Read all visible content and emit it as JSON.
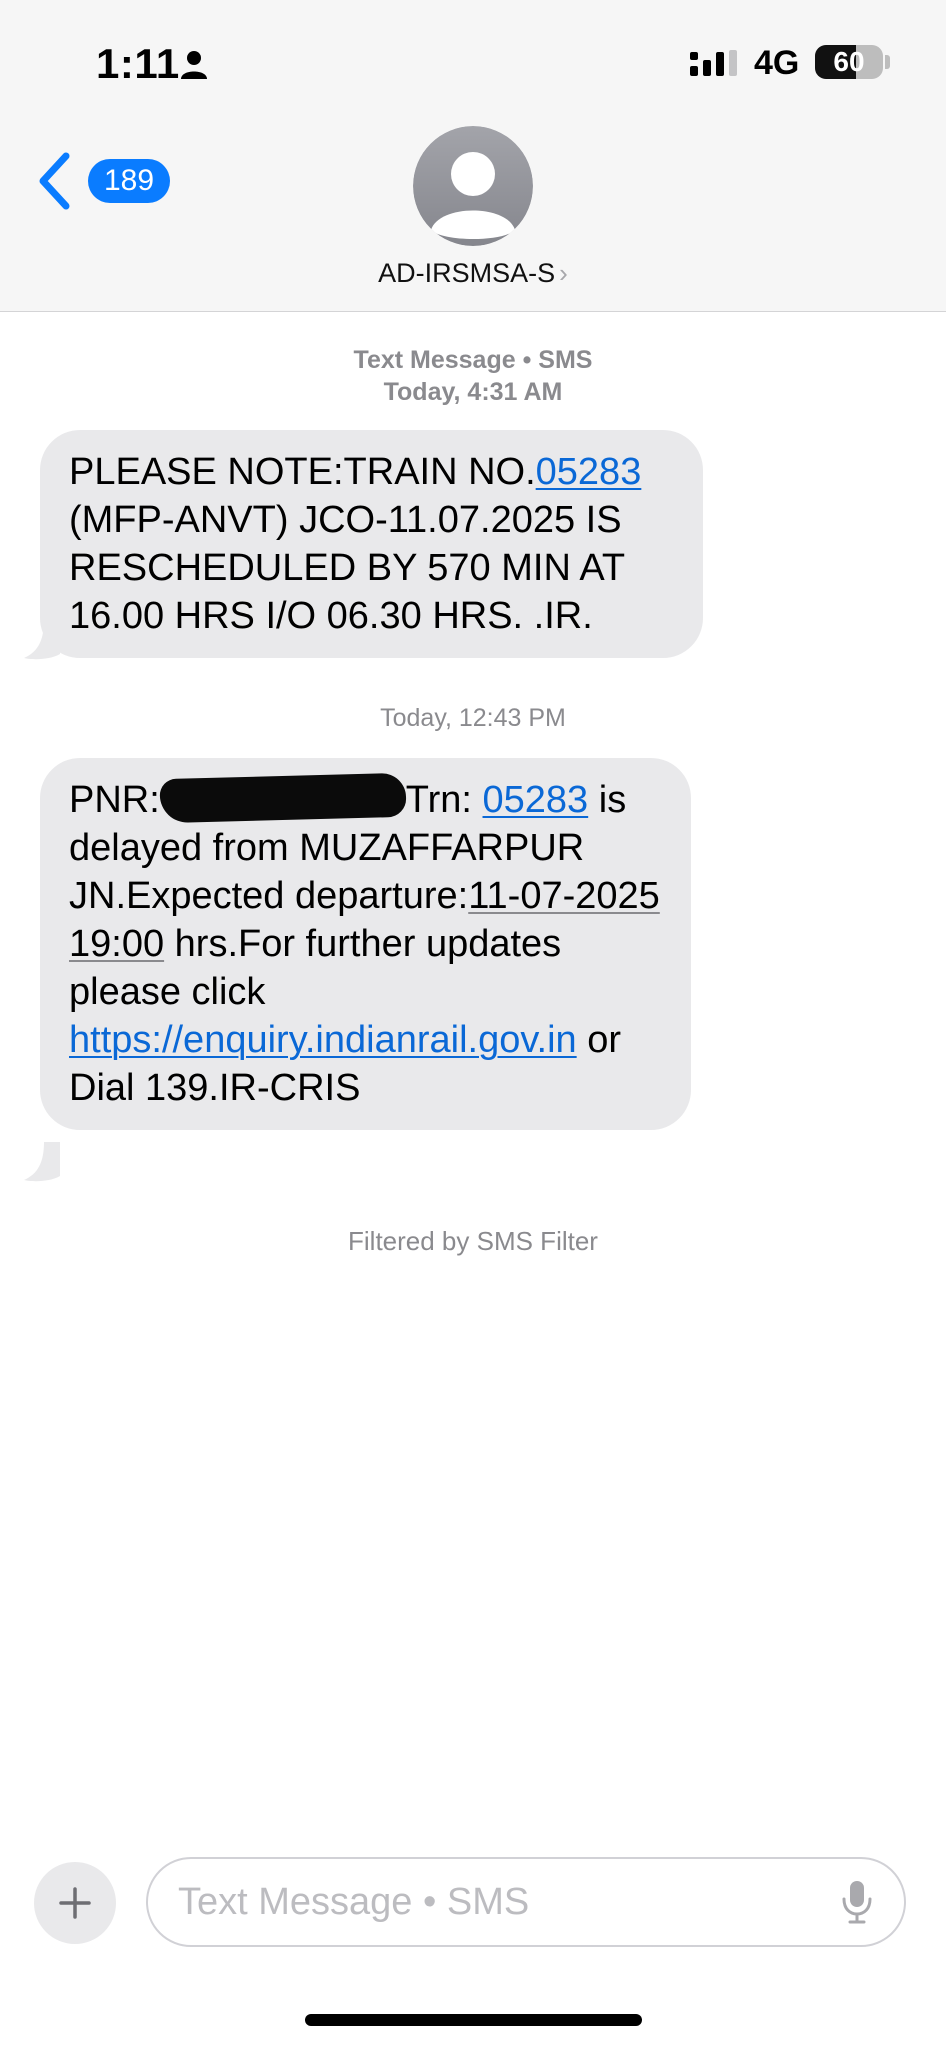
{
  "status_bar": {
    "time": "1:11",
    "network": "4G",
    "battery": "60",
    "battery_level": 0.6
  },
  "nav": {
    "back_count": "189",
    "contact_name": "AD-IRSMSA-S",
    "contact_chevron": "›"
  },
  "messages": [
    {
      "meta_label": "Text Message • SMS",
      "meta_time": "Today, 4:31 AM",
      "text_before_link": "PLEASE NOTE:TRAIN NO.",
      "link": "05283",
      "text_after_link": " (MFP-ANVT) JCO-11.07.2025 IS RESCHEDULED BY 570 MIN AT 16.00 HRS I/O 06.30 HRS. .IR."
    },
    {
      "meta_time": "Today, 12:43 PM",
      "pnr_label": "PNR:",
      "trn_label": "Trn: ",
      "train_link": "05283",
      "text_delayed": " is delayed from MUZAFFARPUR JN.Expected departure:",
      "departure": "11-07-2025 19:00",
      "text_updates": " hrs.For further updates please click ",
      "url_link": "https://enquiry.indianrail.gov.in",
      "text_end": " or Dial 139.IR-CRIS"
    }
  ],
  "filter_note": "Filtered by SMS Filter",
  "composer": {
    "placeholder": "Text Message • SMS"
  },
  "icons": {
    "back": "chevron-left-icon",
    "avatar": "person-silhouette-icon",
    "plus": "plus-icon",
    "mic": "microphone-icon",
    "signal": "cellular-signal-icon"
  },
  "colors": {
    "accent": "#0a7cff",
    "link": "#0a68d6",
    "bubble": "#e9e9eb",
    "meta_text": "#8a8a8e",
    "header_bg": "#f6f6f6"
  }
}
